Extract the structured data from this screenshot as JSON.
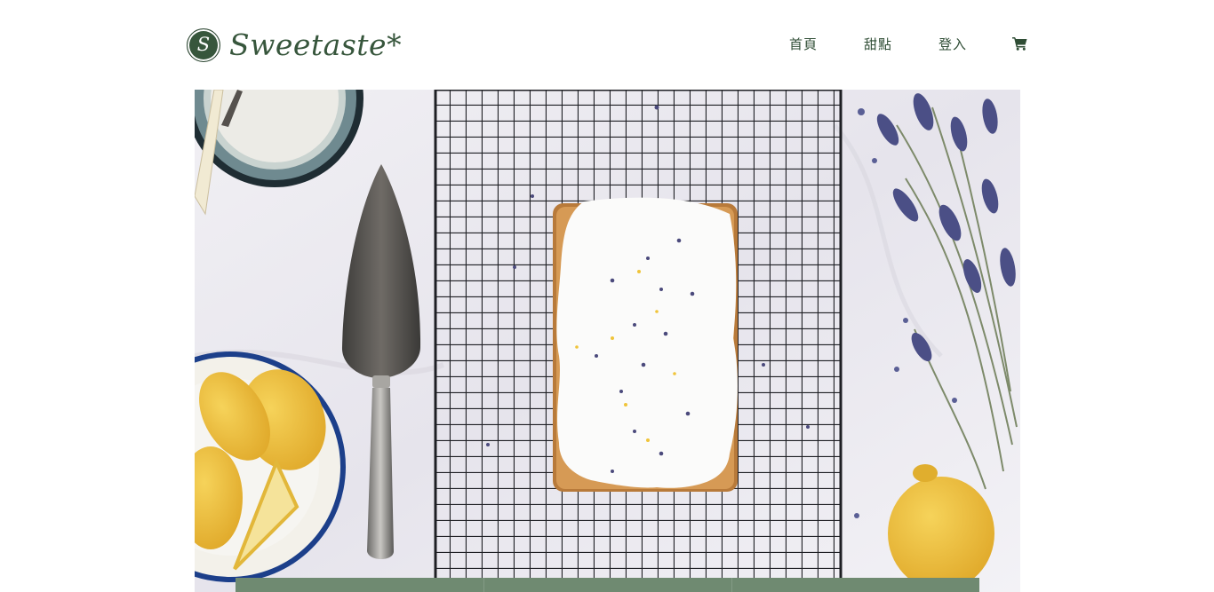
{
  "brand": {
    "mark": "S",
    "name": "Sweetaste*",
    "color": "#37563c"
  },
  "nav": {
    "home": "首頁",
    "desserts": "甜點",
    "login": "登入",
    "cart_icon": "cart-icon"
  },
  "hero": {
    "image": "lemon-lavender-pound-cake-on-cooling-rack"
  },
  "colors": {
    "primary_green": "#37563c",
    "strip_green": "#6f8a71"
  }
}
